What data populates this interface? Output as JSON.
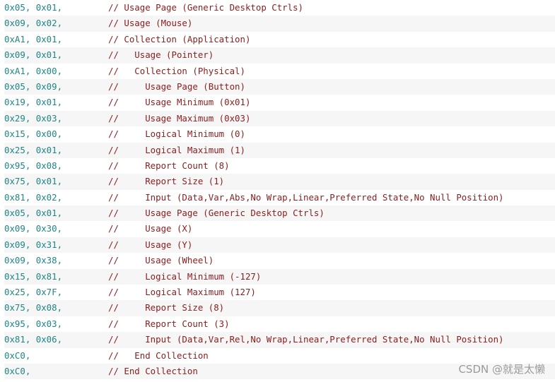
{
  "lines": [
    {
      "code": "0x05, 0x01,",
      "comment": "// Usage Page (Generic Desktop Ctrls)"
    },
    {
      "code": "0x09, 0x02,",
      "comment": "// Usage (Mouse)"
    },
    {
      "code": "0xA1, 0x01,",
      "comment": "// Collection (Application)"
    },
    {
      "code": "0x09, 0x01,",
      "comment": "//   Usage (Pointer)"
    },
    {
      "code": "0xA1, 0x00,",
      "comment": "//   Collection (Physical)"
    },
    {
      "code": "0x05, 0x09,",
      "comment": "//     Usage Page (Button)"
    },
    {
      "code": "0x19, 0x01,",
      "comment": "//     Usage Minimum (0x01)"
    },
    {
      "code": "0x29, 0x03,",
      "comment": "//     Usage Maximum (0x03)"
    },
    {
      "code": "0x15, 0x00,",
      "comment": "//     Logical Minimum (0)"
    },
    {
      "code": "0x25, 0x01,",
      "comment": "//     Logical Maximum (1)"
    },
    {
      "code": "0x95, 0x08,",
      "comment": "//     Report Count (8)"
    },
    {
      "code": "0x75, 0x01,",
      "comment": "//     Report Size (1)"
    },
    {
      "code": "0x81, 0x02,",
      "comment": "//     Input (Data,Var,Abs,No Wrap,Linear,Preferred State,No Null Position)"
    },
    {
      "code": "0x05, 0x01,",
      "comment": "//     Usage Page (Generic Desktop Ctrls)"
    },
    {
      "code": "0x09, 0x30,",
      "comment": "//     Usage (X)"
    },
    {
      "code": "0x09, 0x31,",
      "comment": "//     Usage (Y)"
    },
    {
      "code": "0x09, 0x38,",
      "comment": "//     Usage (Wheel)"
    },
    {
      "code": "0x15, 0x81,",
      "comment": "//     Logical Minimum (-127)"
    },
    {
      "code": "0x25, 0x7F,",
      "comment": "//     Logical Maximum (127)"
    },
    {
      "code": "0x75, 0x08,",
      "comment": "//     Report Size (8)"
    },
    {
      "code": "0x95, 0x03,",
      "comment": "//     Report Count (3)"
    },
    {
      "code": "0x81, 0x06,",
      "comment": "//     Input (Data,Var,Rel,No Wrap,Linear,Preferred State,No Null Position)"
    },
    {
      "code": "0xC0,",
      "comment": "//   End Collection"
    },
    {
      "code": "0xC0,",
      "comment": "// End Collection"
    }
  ],
  "watermark": "CSDN @就是太懒",
  "colors": {
    "hex": "#1f8585",
    "comment": "#8b1c1c",
    "stripe": "#f6f6f6"
  }
}
